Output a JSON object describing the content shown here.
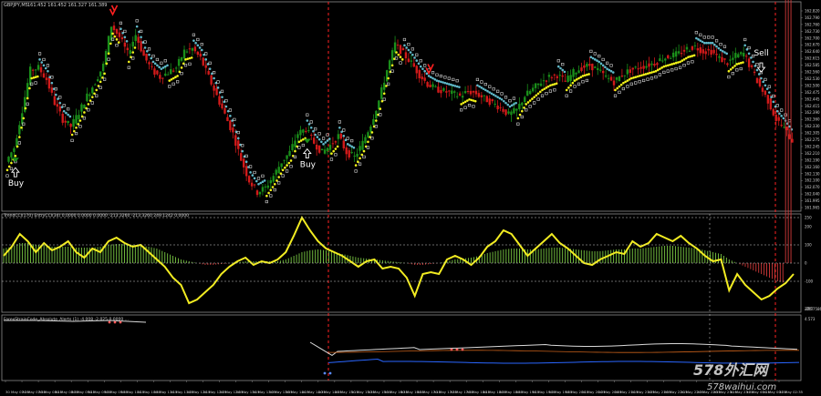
{
  "window": {
    "symbol": "GBPJPY,M5",
    "ohlc": "161.452 161.452 161.327 161.389"
  },
  "colors": {
    "background": "#000000",
    "bull_candle": "#1a8f1a",
    "bear_candle": "#d21a1a",
    "dots_yellow": "#f2f21a",
    "dots_cyan": "#5fb8c8",
    "squares": "#d8d8d8",
    "cci_line": "#f2ec21",
    "cci_hist_pos": "#7ac943",
    "cci_hist_neg": "#d33a3a",
    "grid": "#ffffff",
    "separator": "#ff2222",
    "axis_text": "#d0d0d0",
    "ftd_white": "#d9d9d9",
    "ftd_blue": "#2a66ff",
    "ftd_orange": "#c8601a"
  },
  "signals": {
    "buy_label": "Buy",
    "sell_label": "Sell",
    "buy_icon": "up-arrow-icon",
    "sell_icon": "down-arrow-icon"
  },
  "chart_data": [
    {
      "type": "candlestick",
      "title": "GBPJPY,M5",
      "ylim": [
        161.95,
        162.84
      ],
      "y_ticks": [
        "162.820",
        "162.790",
        "162.760",
        "162.730",
        "162.700",
        "162.670",
        "162.640",
        "162.615",
        "162.585",
        "162.560",
        "162.530",
        "162.500",
        "162.475",
        "162.445",
        "162.415",
        "162.390",
        "162.360",
        "162.330",
        "162.305",
        "162.275",
        "162.245",
        "162.210",
        "162.190",
        "162.160",
        "162.130",
        "162.100",
        "162.070",
        "162.040",
        "161.995",
        "161.965"
      ],
      "close_path": [
        162.16,
        162.22,
        162.38,
        162.55,
        162.56,
        162.51,
        162.41,
        162.34,
        162.31,
        162.37,
        162.44,
        162.5,
        162.57,
        162.74,
        162.69,
        162.62,
        162.7,
        162.61,
        162.55,
        162.52,
        162.54,
        162.56,
        162.63,
        162.64,
        162.6,
        162.52,
        162.44,
        162.36,
        162.28,
        162.17,
        162.08,
        162.03,
        162.05,
        162.1,
        162.16,
        162.2,
        162.28,
        162.3,
        162.24,
        162.2,
        162.23,
        162.27,
        162.2,
        162.18,
        162.24,
        162.32,
        162.42,
        162.55,
        162.66,
        162.62,
        162.58,
        162.53,
        162.49,
        162.47,
        162.46,
        162.45,
        162.44,
        162.46,
        162.45,
        162.43,
        162.41,
        162.39,
        162.36,
        162.38,
        162.44,
        162.47,
        162.5,
        162.52,
        162.53,
        162.5,
        162.54,
        162.56,
        162.57,
        162.55,
        162.52,
        162.5,
        162.53,
        162.55,
        162.56,
        162.57,
        162.58,
        162.6,
        162.61,
        162.62,
        162.64,
        162.65,
        162.63,
        162.63,
        162.6,
        162.58,
        162.61,
        162.62,
        162.55,
        162.48,
        162.42,
        162.34,
        162.3,
        162.25
      ],
      "buy_signals": [
        {
          "label": "Buy",
          "bar_index": 1
        },
        {
          "label": "Buy",
          "bar_index": 37
        }
      ],
      "sell_signals": [
        {
          "label": "Sell",
          "bar_index": 93
        }
      ],
      "arrows_red": [
        13,
        52
      ]
    },
    {
      "type": "line+histogram",
      "title": "TrendCCI(170) EntryCCI(34) 0.0000 0.0000 0.0000 -213.3260 -213.3260 249.1242 0.0000",
      "ylim": [
        -270,
        270
      ],
      "y_ticks": [
        250,
        200,
        100,
        0,
        -100,
        -250
      ],
      "entry_cci": [
        40,
        90,
        160,
        120,
        60,
        110,
        70,
        90,
        120,
        60,
        30,
        80,
        60,
        120,
        140,
        110,
        90,
        100,
        60,
        20,
        -20,
        -80,
        -120,
        -220,
        -200,
        -160,
        -120,
        -60,
        -20,
        10,
        30,
        -10,
        10,
        0,
        20,
        60,
        150,
        250,
        180,
        120,
        80,
        60,
        40,
        10,
        -20,
        10,
        20,
        -30,
        -20,
        -30,
        -80,
        -180,
        -60,
        -50,
        -60,
        20,
        40,
        20,
        -10,
        30,
        90,
        120,
        180,
        160,
        100,
        40,
        80,
        120,
        160,
        110,
        80,
        40,
        0,
        -10,
        20,
        40,
        60,
        50,
        120,
        90,
        110,
        160,
        140,
        120,
        150,
        110,
        80,
        40,
        10,
        20,
        -150,
        -60,
        -120,
        -160,
        -200,
        -180,
        -140,
        -110,
        -60
      ],
      "trend_cci": [
        80,
        90,
        110,
        110,
        100,
        100,
        90,
        90,
        90,
        85,
        85,
        85,
        90,
        100,
        105,
        105,
        100,
        95,
        90,
        80,
        60,
        40,
        20,
        10,
        0,
        -10,
        -10,
        -5,
        0,
        5,
        10,
        10,
        10,
        10,
        10,
        20,
        40,
        60,
        70,
        75,
        70,
        60,
        50,
        40,
        30,
        25,
        20,
        15,
        10,
        5,
        0,
        -10,
        -10,
        -5,
        0,
        10,
        20,
        25,
        30,
        40,
        55,
        65,
        75,
        80,
        80,
        75,
        75,
        80,
        85,
        85,
        80,
        75,
        70,
        65,
        65,
        70,
        75,
        75,
        80,
        80,
        85,
        90,
        95,
        95,
        90,
        85,
        80,
        70,
        60,
        50,
        20,
        0,
        -20,
        -40,
        -60,
        -80,
        -100,
        -110
      ]
    },
    {
      "type": "line",
      "title": "ForexStrainCode_Absolute_Alerts (1) -4.008 -2.025 0.0000 ...",
      "y_ticks": [
        "4.573",
        "296.7586"
      ]
    }
  ],
  "time_axis": [
    "30 May 07:25",
    "30 May 07:55",
    "30 May 08:15",
    "30 May 08:35",
    "30 May 09:15",
    "30 May 09:35",
    "30 May 09:55",
    "30 May 10:15",
    "30 May 10:55",
    "30 May 11:15",
    "30 May 11:35",
    "30 May 12:15",
    "30 May 12:35",
    "30 May 12:55",
    "30 May 13:15",
    "30 May 13:35",
    "30 May 13:55",
    "30 May 14:15",
    "30 May 14:35",
    "30 May 14:55",
    "30 May 15:15",
    "30 May 15:35",
    "30 May 15:55",
    "30 May 16:35",
    "30 May 16:55",
    "30 May 17:15",
    "30 May 17:35",
    "30 May 17:55",
    "30 May 18:15",
    "30 May 18:35",
    "30 May 18:55",
    "30 May 19:15",
    "30 May 19:35",
    "30 May 19:55",
    "30 May 20:15",
    "30 May 20:35",
    "30 May 20:55",
    "30 May 21:15",
    "30 May 21:35",
    "30 May 21:55",
    "30 May 22:15",
    "30 May 22:35",
    "30 May 22:55",
    "30 May 23:15",
    "30 May 23:35",
    "31 May 00:15",
    "31 May 00:35",
    "31 May 02:35"
  ],
  "watermark": {
    "line1": "578外汇网",
    "line2": "578waihui.com"
  }
}
